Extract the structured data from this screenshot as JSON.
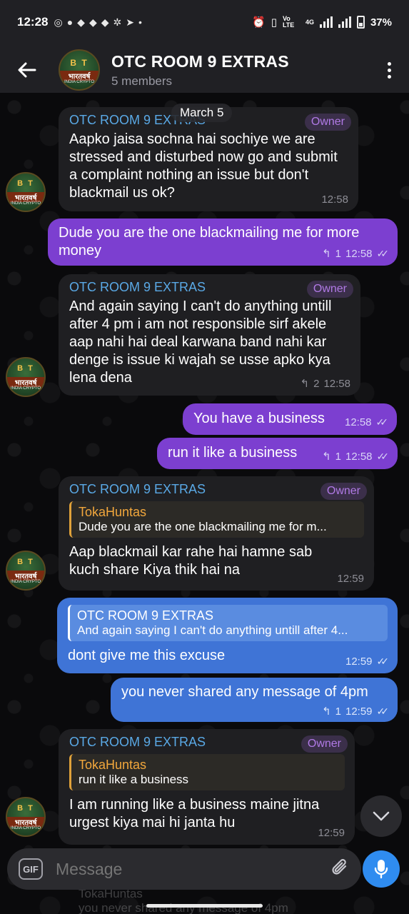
{
  "status_bar": {
    "time": "12:28",
    "left_icons": [
      "whatsapp-icon",
      "chat-icon",
      "discord-icon",
      "discord-icon",
      "discord-icon",
      "network-icon",
      "telegram-icon",
      "dot-icon"
    ],
    "network": "Vo LTE",
    "net_type": "4G",
    "battery": "37%"
  },
  "header": {
    "title": "OTC ROOM 9 EXTRAS",
    "subtitle": "5 members",
    "avatar_text": "भारतवर्ष",
    "avatar_sub": "INDIA CRYPTO",
    "avatar_mark": "B T"
  },
  "date_pill": "March 5",
  "messages": [
    {
      "direction": "in",
      "sender": "OTC ROOM 9 EXTRAS",
      "badge": "Owner",
      "text": "Aapko jaisa sochna hai sochiye we are stressed and disturbed now go and submit a complaint nothing an issue but don't blackmail us ok?",
      "time": "12:58"
    },
    {
      "direction": "out",
      "text": "Dude you are the one blackmailing me for more money",
      "replies": "1",
      "time": "12:58"
    },
    {
      "direction": "in",
      "sender": "OTC ROOM 9 EXTRAS",
      "badge": "Owner",
      "text": "And again saying I can't do anything untill after 4 pm i am not responsible sirf akele aap nahi hai deal karwana band nahi kar denge is issue ki wajah se usse apko kya lena dena",
      "replies": "2",
      "time": "12:58"
    },
    {
      "direction": "out",
      "text": "You have a business",
      "time": "12:58"
    },
    {
      "direction": "out",
      "text": "run it like a business",
      "replies": "1",
      "time": "12:58"
    },
    {
      "direction": "in",
      "sender": "OTC ROOM 9 EXTRAS",
      "badge": "Owner",
      "quote_name": "TokaHuntas",
      "quote_text": "Dude you are the one blackmailing me for m...",
      "text": "Aap blackmail kar rahe hai hamne sab kuch share Kiya thik hai na",
      "time": "12:59"
    },
    {
      "direction": "out",
      "quote_name": "OTC ROOM 9 EXTRAS",
      "quote_text": "And again saying I can't do anything untill after 4...",
      "text": "dont give me this excuse",
      "time": "12:59"
    },
    {
      "direction": "out",
      "text": "you never shared any message of 4pm",
      "replies": "1",
      "time": "12:59"
    },
    {
      "direction": "in",
      "sender": "OTC ROOM 9 EXTRAS",
      "badge": "Owner",
      "quote_name": "TokaHuntas",
      "quote_text": "run it like a business",
      "text": "I am running like a business maine jitna urgest kiya mai hi janta hu",
      "time": "12:59"
    }
  ],
  "composer": {
    "gif_label": "GIF",
    "placeholder": "Message"
  },
  "ghost_text": {
    "line1": "TokaHuntas",
    "line2": "you never shared any message of 4pm"
  }
}
